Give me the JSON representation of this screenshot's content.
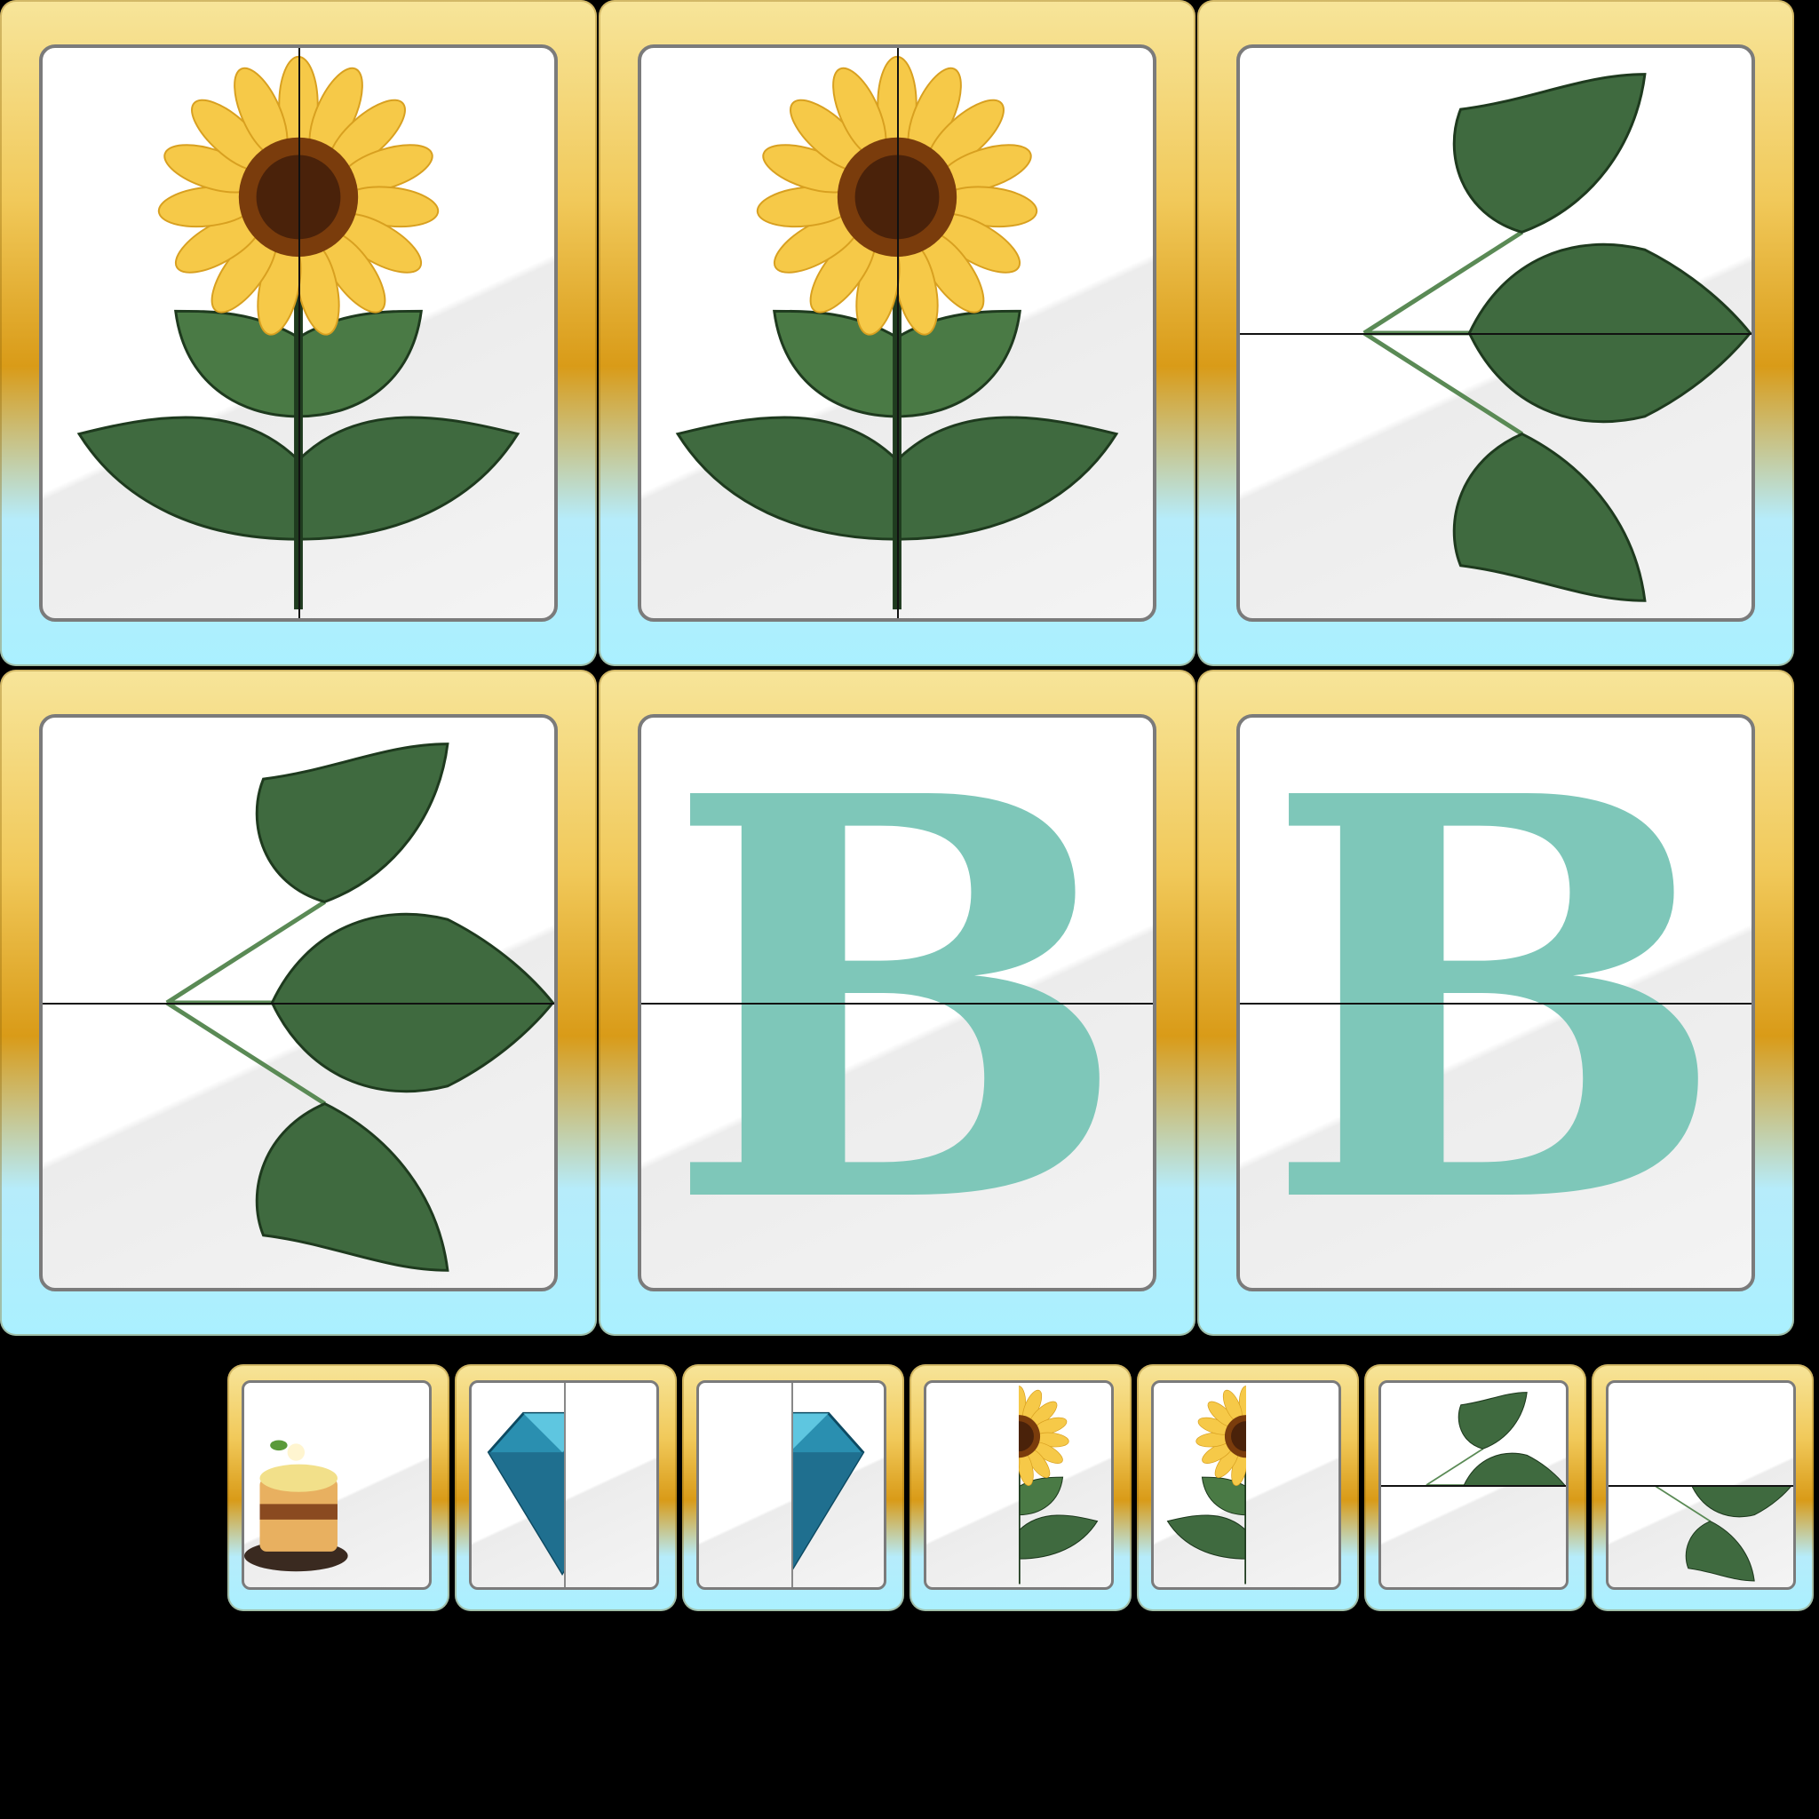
{
  "board": {
    "cards": [
      {
        "id": "card-1",
        "icon": "sunflower-icon",
        "split": "vertical"
      },
      {
        "id": "card-2",
        "icon": "sunflower-icon",
        "split": "vertical"
      },
      {
        "id": "card-3",
        "icon": "leaf-branch-icon",
        "split": "horizontal"
      },
      {
        "id": "card-4",
        "icon": "leaf-branch-icon",
        "split": "horizontal"
      },
      {
        "id": "card-5",
        "icon": "letter-b-icon",
        "letter": "B",
        "split": "horizontal"
      },
      {
        "id": "card-6",
        "icon": "letter-b-icon",
        "letter": "B",
        "split": "horizontal"
      }
    ]
  },
  "tray": {
    "pieces": [
      {
        "id": "piece-1",
        "icon": "cake-half-icon"
      },
      {
        "id": "piece-2",
        "icon": "diamond-left-half-icon"
      },
      {
        "id": "piece-3",
        "icon": "diamond-right-half-icon"
      },
      {
        "id": "piece-4",
        "icon": "sunflower-right-half-icon"
      },
      {
        "id": "piece-5",
        "icon": "sunflower-left-half-icon"
      },
      {
        "id": "piece-6",
        "icon": "leaf-branch-top-half-icon"
      },
      {
        "id": "piece-7",
        "icon": "leaf-branch-bottom-half-icon"
      }
    ]
  },
  "colors": {
    "gold": "#d99b18",
    "sky": "#aaf0ff",
    "leaf": "#3f6a3f",
    "letter": "#7ec7b9",
    "diamond": "#2a8fb0"
  }
}
